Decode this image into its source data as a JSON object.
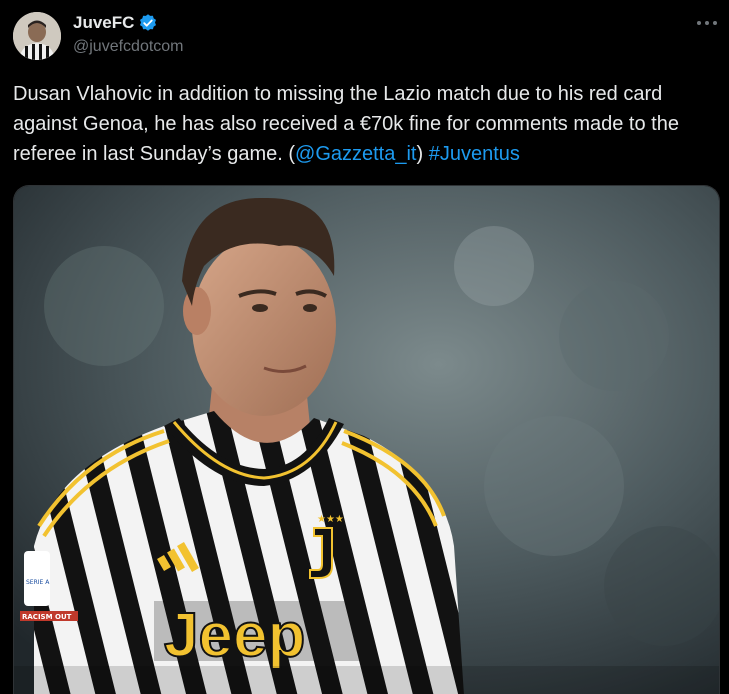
{
  "author": {
    "name": "JuveFC",
    "handle": "@juvefcdotcom",
    "verified_icon": "verified-badge-icon",
    "avatar_icon": "profile-avatar"
  },
  "menu": {
    "icon": "more-options-icon",
    "label": "···"
  },
  "tweet": {
    "text_main": "Dusan Vlahovic in addition to missing the Lazio match due to his red card against Genoa, he has also received a €70k fine for comments made to the referee in last Sunday’s game. (",
    "mention": "@Gazzetta_it",
    "text_mid": ") ",
    "hashtag": "#Juventus"
  },
  "media": {
    "sponsor_text": "Jeep",
    "sleeve_patch": "SERIE A",
    "sleeve_text": "RACISM OUT"
  },
  "colors": {
    "background": "#000000",
    "text": "#e7e9ea",
    "secondary": "#71767b",
    "link": "#1d9bf0",
    "kit_gold": "#f2c230"
  }
}
